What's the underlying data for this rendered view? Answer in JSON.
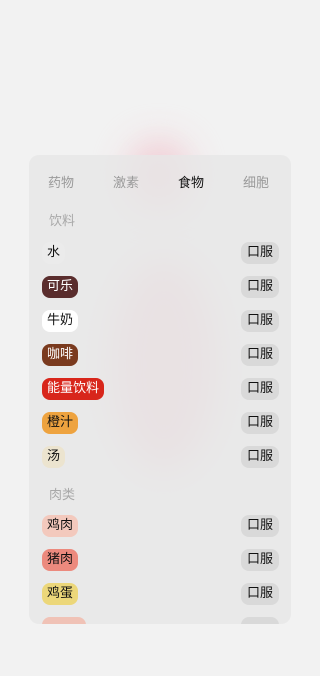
{
  "tabs": [
    {
      "label": "药物",
      "active": false
    },
    {
      "label": "激素",
      "active": false
    },
    {
      "label": "食物",
      "active": true
    },
    {
      "label": "细胞",
      "active": false
    }
  ],
  "sections": {
    "drinks": "饮料",
    "meat": "肉类"
  },
  "rows": [
    {
      "name": "水",
      "route": "口服",
      "bg": "#ebebeb",
      "fg": "#111111"
    },
    {
      "name": "可乐",
      "route": "口服",
      "bg": "#5a2d2d",
      "fg": "#ffffff"
    },
    {
      "name": "牛奶",
      "route": "口服",
      "bg": "#ffffff",
      "fg": "#111111"
    },
    {
      "name": "咖啡",
      "route": "口服",
      "bg": "#7a3a1e",
      "fg": "#ffffff"
    },
    {
      "name": "能量饮料",
      "route": "口服",
      "bg": "#d8261b",
      "fg": "#ffffff"
    },
    {
      "name": "橙汁",
      "route": "口服",
      "bg": "#eea33f",
      "fg": "#111111"
    },
    {
      "name": "汤",
      "route": "口服",
      "bg": "#ece4cf",
      "fg": "#111111"
    },
    {
      "name": "鸡肉",
      "route": "口服",
      "bg": "#f3c9bd",
      "fg": "#111111"
    },
    {
      "name": "猪肉",
      "route": "口服",
      "bg": "#ec8a7e",
      "fg": "#111111"
    },
    {
      "name": "鸡蛋",
      "route": "口服",
      "bg": "#ecd77a",
      "fg": "#111111"
    },
    {
      "name": "",
      "route": "",
      "bg": "#f0c2b6",
      "fg": "#111111"
    }
  ]
}
